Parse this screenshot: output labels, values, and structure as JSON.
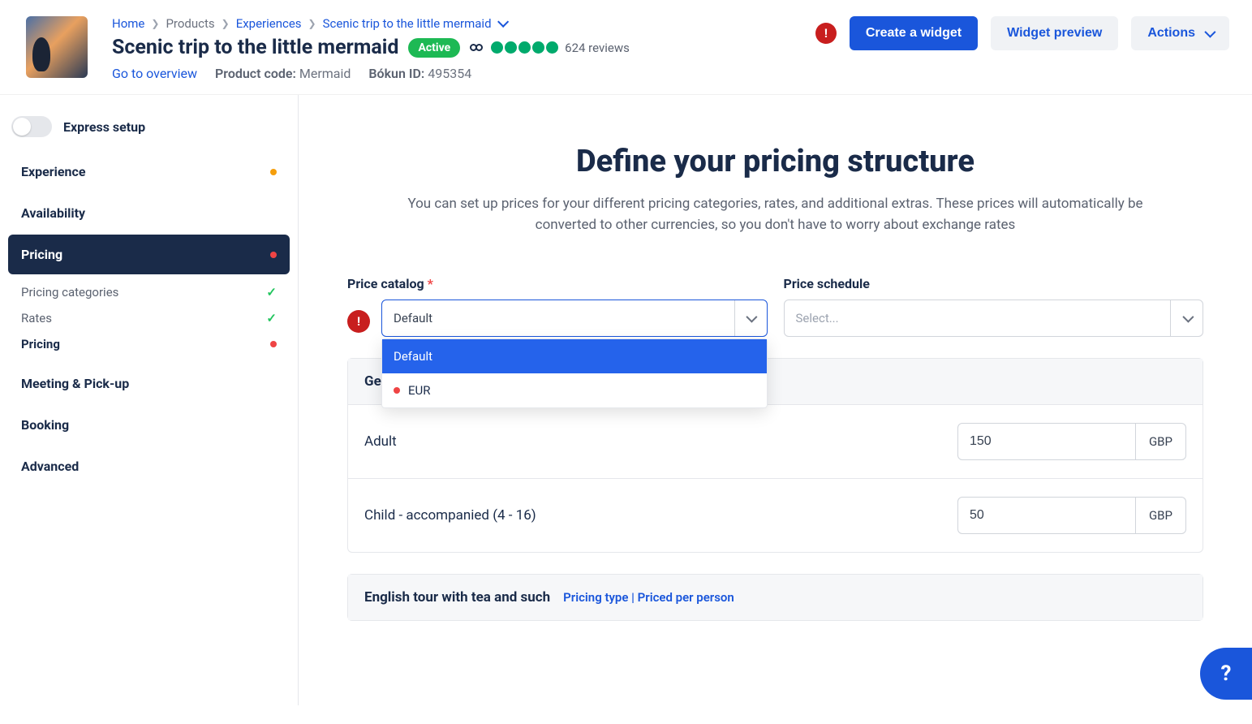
{
  "breadcrumb": {
    "home": "Home",
    "products": "Products",
    "experiences": "Experiences",
    "current": "Scenic trip to the little mermaid"
  },
  "header": {
    "title": "Scenic trip to the little mermaid",
    "status_badge": "Active",
    "reviews": "624 reviews",
    "overview_link": "Go to overview",
    "product_code_label": "Product code:",
    "product_code": "Mermaid",
    "bokun_id_label": "Bókun ID:",
    "bokun_id": "495354"
  },
  "actions": {
    "create_widget": "Create a widget",
    "widget_preview": "Widget preview",
    "actions": "Actions"
  },
  "sidebar": {
    "express": "Express setup",
    "items": [
      {
        "label": "Experience"
      },
      {
        "label": "Availability"
      },
      {
        "label": "Pricing"
      },
      {
        "label": "Meeting & Pick-up"
      },
      {
        "label": "Booking"
      },
      {
        "label": "Advanced"
      }
    ],
    "pricing_sub": [
      {
        "label": "Pricing categories"
      },
      {
        "label": "Rates"
      },
      {
        "label": "Pricing"
      }
    ]
  },
  "main": {
    "title": "Define your pricing structure",
    "subtitle": "You can set up prices for your different pricing categories, rates, and additional extras. These prices will automatically be converted to other currencies, so you don't have to worry about exchange rates",
    "catalog_label": "Price catalog",
    "catalog_value": "Default",
    "catalog_options": [
      {
        "label": "Default"
      },
      {
        "label": "EUR"
      }
    ],
    "schedule_label": "Price schedule",
    "schedule_placeholder": "Select...",
    "sections": [
      {
        "title": "Ger",
        "rows": [
          {
            "label": "Adult",
            "price": "150",
            "currency": "GBP"
          },
          {
            "label": "Child - accompanied (4 - 16)",
            "price": "50",
            "currency": "GBP"
          }
        ]
      },
      {
        "title": "English tour with tea and such",
        "pricing_type_label": "Pricing type",
        "pricing_type_value": "Priced per person"
      }
    ]
  }
}
